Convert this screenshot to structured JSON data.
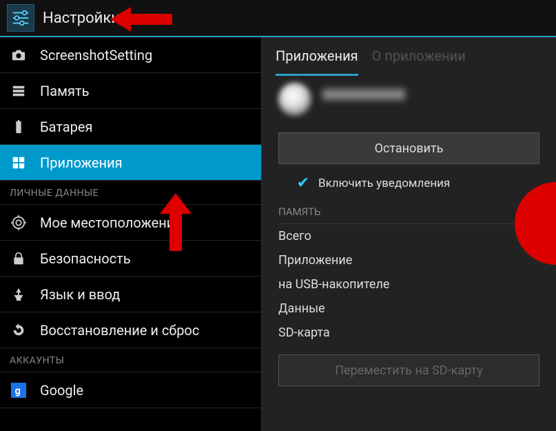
{
  "header": {
    "title": "Настройки"
  },
  "sidebar": {
    "items": [
      {
        "label": "ScreenshotSetting",
        "icon": "camera-icon"
      },
      {
        "label": "Память",
        "icon": "storage-icon"
      },
      {
        "label": "Батарея",
        "icon": "battery-icon"
      },
      {
        "label": "Приложения",
        "icon": "apps-icon",
        "selected": true
      }
    ],
    "section_personal": "ЛИЧНЫЕ ДАННЫЕ",
    "personal_items": [
      {
        "label": "Мое местоположение",
        "icon": "location-icon"
      },
      {
        "label": "Безопасность",
        "icon": "lock-icon"
      },
      {
        "label": "Язык и ввод",
        "icon": "language-icon"
      },
      {
        "label": "Восстановление и сброс",
        "icon": "reset-icon"
      }
    ],
    "section_accounts": "АККАУНТЫ",
    "account_items": [
      {
        "label": "Google",
        "icon": "google-icon"
      }
    ]
  },
  "main": {
    "tabs": {
      "active": "Приложения",
      "inactive": "О приложении"
    },
    "stop_button": "Остановить",
    "notify_checkbox": "Включить уведомления",
    "notify_checked": true,
    "memory": {
      "header": "ПАМЯТЬ",
      "rows": [
        "Всего",
        "Приложение",
        "на USB-накопителе",
        "Данные",
        "SD-карта"
      ]
    },
    "move_button": "Переместить на SD-карту"
  }
}
